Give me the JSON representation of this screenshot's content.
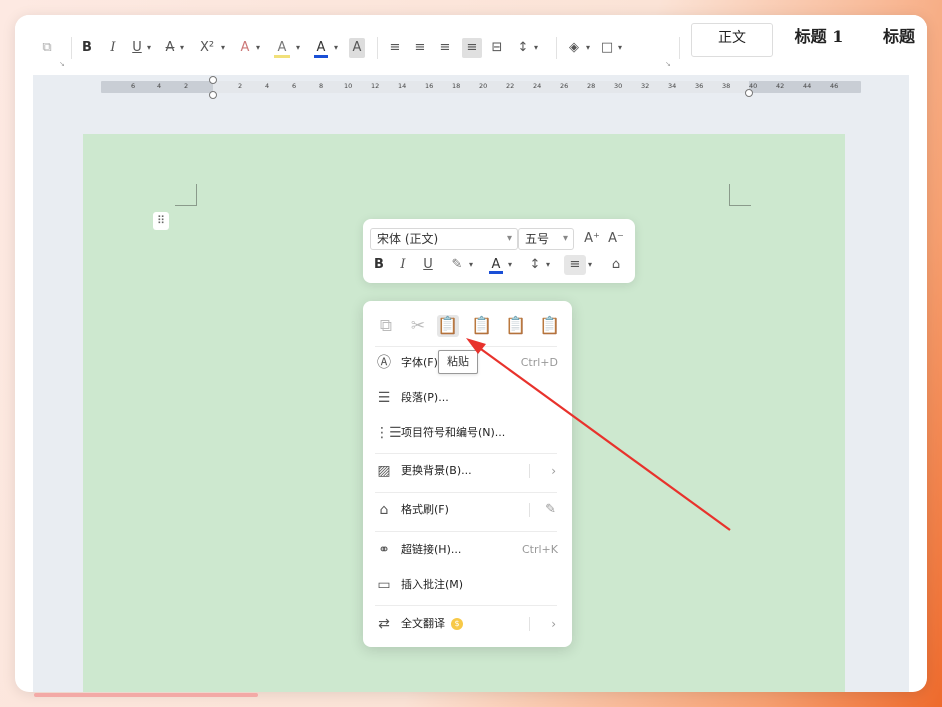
{
  "toolbar": {
    "bold": "B",
    "italic": "I",
    "underline": "U",
    "strikethrough": "A",
    "superscript": "X²",
    "text_effect": "A",
    "highlight": "A",
    "font_color": "A",
    "char_shading": "A",
    "style_normal": "正文",
    "style_heading1": "标题 1",
    "style_heading2": "标题"
  },
  "ruler": {
    "labels": [
      "6",
      "4",
      "2",
      "2",
      "4",
      "6",
      "8",
      "10",
      "12",
      "14",
      "16",
      "18",
      "20",
      "22",
      "24",
      "26",
      "28",
      "30",
      "32",
      "34",
      "36",
      "38",
      "40",
      "42",
      "44",
      "46"
    ]
  },
  "mini_toolbar": {
    "font_name": "宋体 (正文)",
    "font_size": "五号",
    "grow_font": "A⁺",
    "shrink_font": "A⁻",
    "bold": "B",
    "italic": "I",
    "underline": "U",
    "font_color": "A"
  },
  "context_menu": {
    "items": [
      {
        "label": "字体(F)",
        "shortcut": "Ctrl+D"
      },
      {
        "label": "段落(P)..."
      },
      {
        "label": "项目符号和编号(N)..."
      },
      {
        "label": "更换背景(B)..."
      },
      {
        "label": "格式刷(F)"
      },
      {
        "label": "超链接(H)...",
        "shortcut": "Ctrl+K"
      },
      {
        "label": "插入批注(M)"
      },
      {
        "label": "全文翻译"
      }
    ],
    "tooltip": "粘贴"
  },
  "colors": {
    "page_background": "#cde8cf",
    "annotation_arrow": "#e8322c",
    "font_color_bar": "#1a4fd6"
  }
}
